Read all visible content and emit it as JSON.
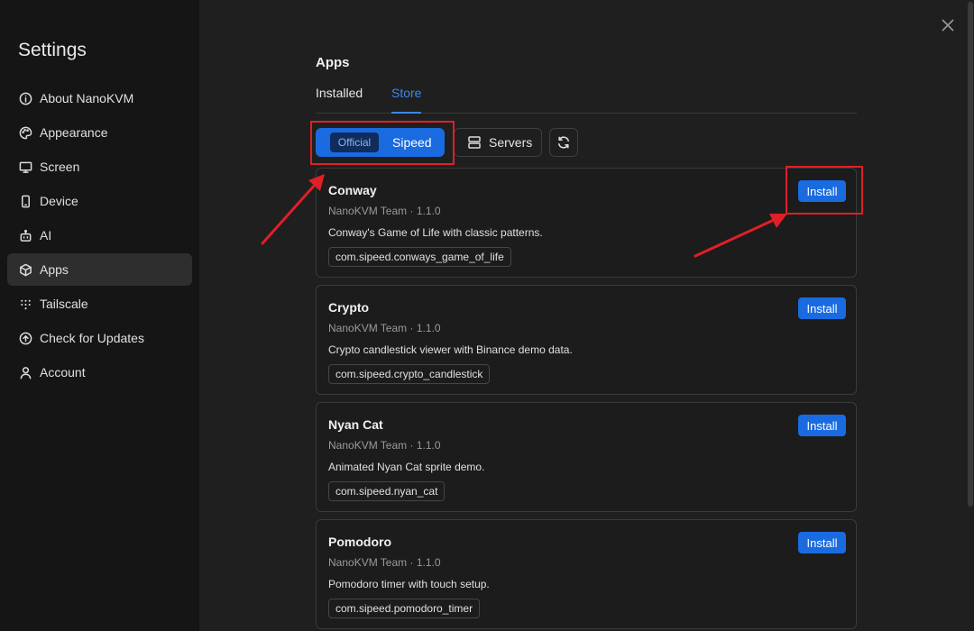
{
  "sidebar": {
    "title": "Settings",
    "items": [
      {
        "label": "About NanoKVM",
        "icon": "info-icon"
      },
      {
        "label": "Appearance",
        "icon": "palette-icon"
      },
      {
        "label": "Screen",
        "icon": "monitor-icon"
      },
      {
        "label": "Device",
        "icon": "phone-icon"
      },
      {
        "label": "AI",
        "icon": "robot-icon"
      },
      {
        "label": "Apps",
        "icon": "box-icon",
        "active": true
      },
      {
        "label": "Tailscale",
        "icon": "dots-grid-icon"
      },
      {
        "label": "Check for Updates",
        "icon": "upload-circle-icon"
      },
      {
        "label": "Account",
        "icon": "user-icon"
      }
    ]
  },
  "page": {
    "title": "Apps",
    "tabs": [
      {
        "label": "Installed"
      },
      {
        "label": "Store",
        "active": true
      }
    ]
  },
  "filters": {
    "segment_inactive": "Official",
    "segment_active": "Sipeed",
    "servers_label": "Servers"
  },
  "apps": [
    {
      "name": "Conway",
      "meta": "NanoKVM Team · 1.1.0",
      "description": "Conway's Game of Life with classic patterns.",
      "id": "com.sipeed.conways_game_of_life",
      "button": "Install"
    },
    {
      "name": "Crypto",
      "meta": "NanoKVM Team · 1.1.0",
      "description": "Crypto candlestick viewer with Binance demo data.",
      "id": "com.sipeed.crypto_candlestick",
      "button": "Install"
    },
    {
      "name": "Nyan Cat",
      "meta": "NanoKVM Team · 1.1.0",
      "description": "Animated Nyan Cat sprite demo.",
      "id": "com.sipeed.nyan_cat",
      "button": "Install"
    },
    {
      "name": "Pomodoro",
      "meta": "NanoKVM Team · 1.1.0",
      "description": "Pomodoro timer with touch setup.",
      "id": "com.sipeed.pomodoro_timer",
      "button": "Install"
    }
  ],
  "colors": {
    "accent": "#1a6be0",
    "tab_active": "#3b86f0",
    "annotation": "#e01f27"
  }
}
